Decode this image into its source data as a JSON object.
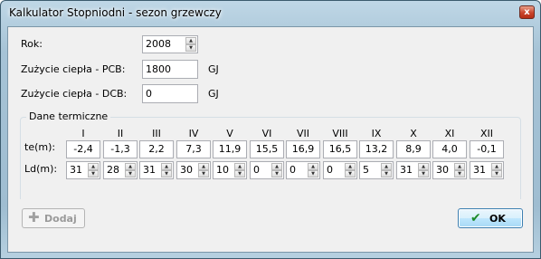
{
  "window": {
    "title": "Kalkulator Stopniodni - sezon grzewczy",
    "close_glyph": "x"
  },
  "form": {
    "rok_label": "Rok:",
    "rok_value": "2008",
    "pcb_label": "Zużycie ciepła - PCB:",
    "pcb_value": "1800",
    "pcb_unit": "GJ",
    "dcb_label": "Zużycie ciepła - DCB:",
    "dcb_value": "0",
    "dcb_unit": "GJ"
  },
  "thermal": {
    "group_title": "Dane termiczne",
    "te_label": "te(m):",
    "ld_label": "Ld(m):",
    "months": [
      "I",
      "II",
      "III",
      "IV",
      "V",
      "VI",
      "VII",
      "VIII",
      "IX",
      "X",
      "XI",
      "XII"
    ],
    "te_values": [
      "-2,4",
      "-1,3",
      "2,2",
      "7,3",
      "11,9",
      "15,5",
      "16,9",
      "16,5",
      "13,2",
      "8,9",
      "4,0",
      "-0,1"
    ],
    "ld_values": [
      "31",
      "28",
      "31",
      "30",
      "10",
      "0",
      "0",
      "0",
      "5",
      "31",
      "30",
      "31"
    ]
  },
  "buttons": {
    "add_label": "Dodaj",
    "ok_label": "OK"
  },
  "icons": {
    "add": "plus-icon",
    "ok": "checkmark-icon",
    "spin_up": "arrow-up-icon",
    "spin_down": "arrow-down-icon"
  }
}
